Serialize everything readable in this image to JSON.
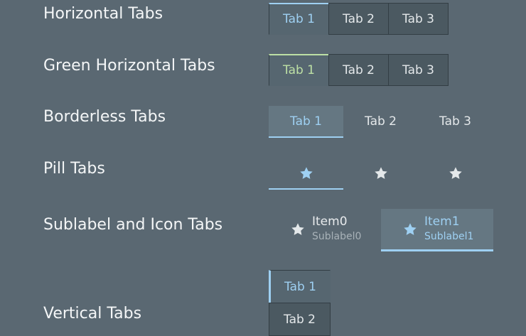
{
  "rows": [
    {
      "label": "Horizontal Tabs",
      "tabs": [
        "Tab 1",
        "Tab 2",
        "Tab 3"
      ]
    },
    {
      "label": "Green Horizontal Tabs",
      "tabs": [
        "Tab 1",
        "Tab 2",
        "Tab 3"
      ]
    },
    {
      "label": "Borderless Tabs",
      "tabs": [
        "Tab 1",
        "Tab 2",
        "Tab 3"
      ]
    },
    {
      "label": "Pill Tabs",
      "tabs": [
        "star-icon",
        "star-icon",
        "star-icon"
      ]
    },
    {
      "label": "Sublabel and Icon Tabs",
      "tabs": [
        {
          "label": "Item0",
          "sublabel": "Sublabel0",
          "icon": "star-icon"
        },
        {
          "label": "Item1",
          "sublabel": "Sublabel1",
          "icon": "star-icon"
        }
      ]
    },
    {
      "label": "Vertical Tabs",
      "tabs": [
        "Tab 1",
        "Tab 2"
      ]
    }
  ],
  "colors": {
    "background": "#5a6872",
    "accent_blue": "#9ed0f2",
    "accent_green": "#bde0a5",
    "tab_background": "#4b5961"
  },
  "selected": {
    "horizontal": 0,
    "green": 0,
    "borderless": 0,
    "pill": 0,
    "sublabel": 1,
    "vertical": 0
  }
}
